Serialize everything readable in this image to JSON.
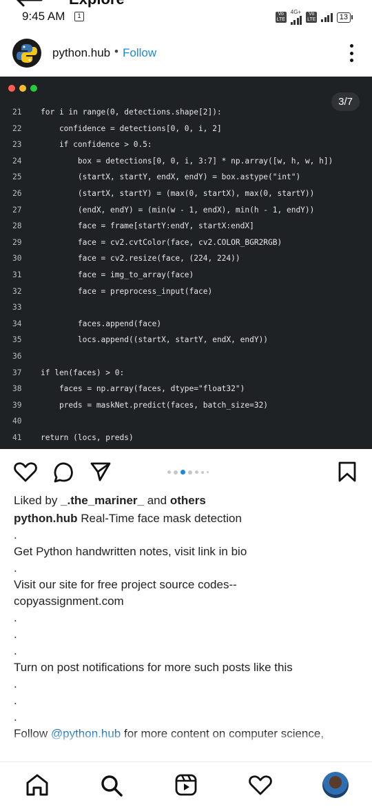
{
  "status_bar": {
    "screen_title": "Explore",
    "time": "9:45 AM",
    "net_label": "4G+",
    "lte_label": "Vo LTE",
    "battery": "13"
  },
  "post": {
    "account": "python.hub",
    "separator": "•",
    "follow_label": "Follow",
    "page_counter": "3/7",
    "window_dot_colors": [
      "#ff5f56",
      "#ffbd2e",
      "#27c93f"
    ],
    "code": [
      {
        "n": "21",
        "t": "for i in range(0, detections.shape[2]):"
      },
      {
        "n": "22",
        "t": "    confidence = detections[0, 0, i, 2]"
      },
      {
        "n": "23",
        "t": "    if confidence > 0.5:"
      },
      {
        "n": "24",
        "t": "        box = detections[0, 0, i, 3:7] * np.array([w, h, w, h])"
      },
      {
        "n": "25",
        "t": "        (startX, startY, endX, endY) = box.astype(\"int\")"
      },
      {
        "n": "26",
        "t": "        (startX, startY) = (max(0, startX), max(0, startY))"
      },
      {
        "n": "27",
        "t": "        (endX, endY) = (min(w - 1, endX), min(h - 1, endY))"
      },
      {
        "n": "28",
        "t": "        face = frame[startY:endY, startX:endX]"
      },
      {
        "n": "29",
        "t": "        face = cv2.cvtColor(face, cv2.COLOR_BGR2RGB)"
      },
      {
        "n": "30",
        "t": "        face = cv2.resize(face, (224, 224))"
      },
      {
        "n": "31",
        "t": "        face = img_to_array(face)"
      },
      {
        "n": "32",
        "t": "        face = preprocess_input(face)"
      },
      {
        "n": "33",
        "t": ""
      },
      {
        "n": "34",
        "t": "        faces.append(face)"
      },
      {
        "n": "35",
        "t": "        locs.append((startX, startY, endX, endY))"
      },
      {
        "n": "36",
        "t": ""
      },
      {
        "n": "37",
        "t": "if len(faces) > 0:"
      },
      {
        "n": "38",
        "t": "    faces = np.array(faces, dtype=\"float32\")"
      },
      {
        "n": "39",
        "t": "    preds = maskNet.predict(faces, batch_size=32)"
      },
      {
        "n": "40",
        "t": ""
      },
      {
        "n": "41",
        "t": "return (locs, preds)"
      }
    ],
    "carousel": {
      "count": 7,
      "active": 3
    },
    "liked_prefix": "Liked by ",
    "liked_user": "_.the_mariner_",
    "liked_and": " and ",
    "liked_others": "others",
    "caption_account": "python.hub",
    "caption_title": " Real-Time face mask detection",
    "dot": ".",
    "line_notes": "Get Python handwritten notes, visit link in bio",
    "line_site_1": "Visit our site for free project source codes--",
    "line_site_2": "copyassignment.com",
    "line_notify": "Turn on post notifications for more such posts like this",
    "follow_prefix": "Follow ",
    "follow_mention": "@python.hub",
    "follow_suffix": " for more content on computer science,"
  },
  "icons": {
    "action": [
      "heart-icon",
      "comment-icon",
      "share-icon",
      "bookmark-icon"
    ],
    "nav": [
      "home-icon",
      "search-icon",
      "reels-icon",
      "activity-heart-icon",
      "profile-avatar"
    ]
  }
}
